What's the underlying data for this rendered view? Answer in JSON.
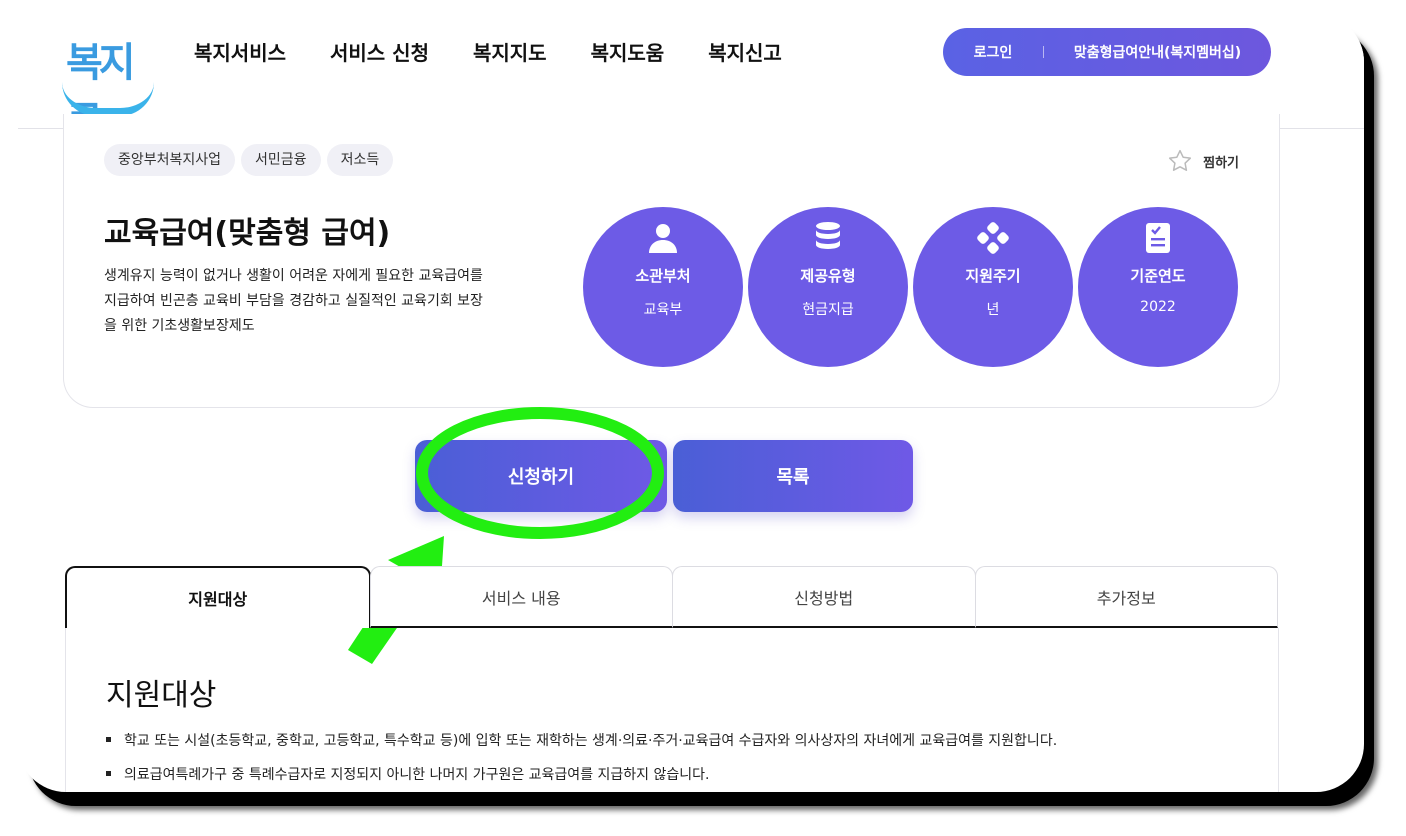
{
  "header": {
    "logo_text": "복지로",
    "nav": [
      "복지서비스",
      "서비스 신청",
      "복지지도",
      "복지도움",
      "복지신고"
    ],
    "login_label": "로그인",
    "member_label": "맞춤형급여안내(복지멤버십)"
  },
  "service": {
    "tags": [
      "중앙부처복지사업",
      "서민금융",
      "저소득"
    ],
    "bookmark_label": "찜하기",
    "title": "교육급여(맞춤형 급여)",
    "description": "생계유지 능력이 없거나 생활이 어려운 자에게 필요한 교육급여를 지급하여 빈곤층 교육비 부담을 경감하고 실질적인 교육기회 보장을 위한 기초생활보장제도",
    "info": [
      {
        "label": "소관부처",
        "value": "교육부",
        "icon": "person-icon"
      },
      {
        "label": "제공유형",
        "value": "현금지급",
        "icon": "database-icon"
      },
      {
        "label": "지원주기",
        "value": "년",
        "icon": "dots-icon"
      },
      {
        "label": "기준연도",
        "value": "2022",
        "icon": "clipboard-icon"
      }
    ]
  },
  "actions": {
    "apply_label": "신청하기",
    "list_label": "목록"
  },
  "tabs": [
    "지원대상",
    "서비스 내용",
    "신청방법",
    "추가정보"
  ],
  "section": {
    "title": "지원대상",
    "bullets": [
      "학교 또는 시설(초등학교, 중학교, 고등학교, 특수학교 등)에 입학 또는 재학하는 생계·의료·주거·교육급여 수급자와 의사상자의 자녀에게 교육급여를 지원합니다.",
      "의료급여특례가구 중 특례수급자로 지정되지 아니한 나머지 가구원은 교육급여를 지급하지 않습니다."
    ]
  },
  "colors": {
    "accent": "#6d5be6",
    "annotation": "#22ee11"
  }
}
